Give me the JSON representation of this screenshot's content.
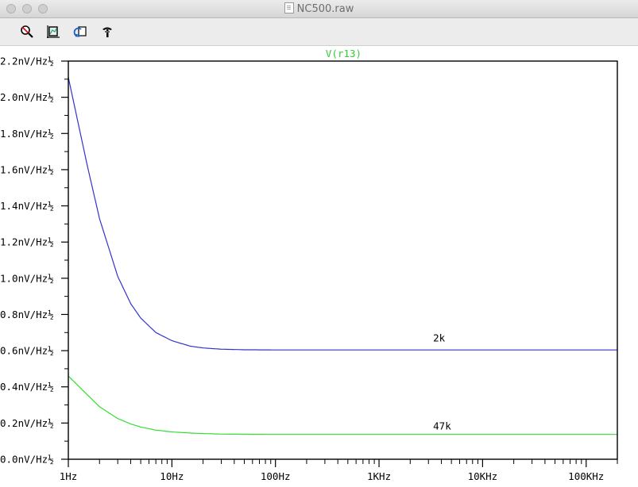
{
  "window": {
    "title": "NC500.raw",
    "controls": [
      "close",
      "minimize",
      "zoom"
    ]
  },
  "toolbar": {
    "tools": [
      {
        "name": "zoom-icon"
      },
      {
        "name": "autorange-icon"
      },
      {
        "name": "undo-zoom-icon"
      },
      {
        "name": "probe-icon"
      }
    ]
  },
  "colors": {
    "trace_title": "#33cc33",
    "series_2k": "#3333cc",
    "series_47k": "#33dd33",
    "axis": "#000000"
  },
  "chart_data": {
    "type": "line",
    "title": "V(r13)",
    "xscale": "log",
    "xlim": [
      1,
      200000
    ],
    "ylim": [
      0,
      2.2
    ],
    "grid": false,
    "x_ticks": [
      {
        "value": 1,
        "label": "1Hz"
      },
      {
        "value": 10,
        "label": "10Hz"
      },
      {
        "value": 100,
        "label": "100Hz"
      },
      {
        "value": 1000,
        "label": "1KHz"
      },
      {
        "value": 10000,
        "label": "10KHz"
      },
      {
        "value": 100000,
        "label": "100KHz"
      }
    ],
    "y_ticks": [
      {
        "value": 2.2,
        "label": "2.2nV/Hz½"
      },
      {
        "value": 2.0,
        "label": "2.0nV/Hz½"
      },
      {
        "value": 1.8,
        "label": "1.8nV/Hz½"
      },
      {
        "value": 1.6,
        "label": "1.6nV/Hz½"
      },
      {
        "value": 1.4,
        "label": "1.4nV/Hz½"
      },
      {
        "value": 1.2,
        "label": "1.2nV/Hz½"
      },
      {
        "value": 1.0,
        "label": "1.0nV/Hz½"
      },
      {
        "value": 0.8,
        "label": "0.8nV/Hz½"
      },
      {
        "value": 0.6,
        "label": "0.6nV/Hz½"
      },
      {
        "value": 0.4,
        "label": "0.4nV/Hz½"
      },
      {
        "value": 0.2,
        "label": "0.2nV/Hz½"
      },
      {
        "value": 0.0,
        "label": "0.0nV/Hz½"
      }
    ],
    "series": [
      {
        "label": "2k",
        "label_at": {
          "x": 5000,
          "y": 0.65
        },
        "x": [
          1,
          1.5,
          2,
          3,
          4,
          5,
          7,
          10,
          15,
          20,
          30,
          50,
          100,
          1000,
          10000,
          100000,
          200000
        ],
        "y": [
          2.11,
          1.64,
          1.33,
          1.01,
          0.86,
          0.78,
          0.7,
          0.655,
          0.625,
          0.615,
          0.608,
          0.605,
          0.604,
          0.604,
          0.604,
          0.604,
          0.604
        ]
      },
      {
        "label": "47k",
        "label_at": {
          "x": 5000,
          "y": 0.165
        },
        "x": [
          1,
          1.5,
          2,
          3,
          4,
          5,
          7,
          10,
          15,
          20,
          30,
          50,
          100,
          1000,
          10000,
          100000,
          200000
        ],
        "y": [
          0.46,
          0.36,
          0.29,
          0.225,
          0.195,
          0.178,
          0.161,
          0.151,
          0.145,
          0.142,
          0.139,
          0.138,
          0.137,
          0.137,
          0.137,
          0.137,
          0.137
        ]
      }
    ]
  }
}
